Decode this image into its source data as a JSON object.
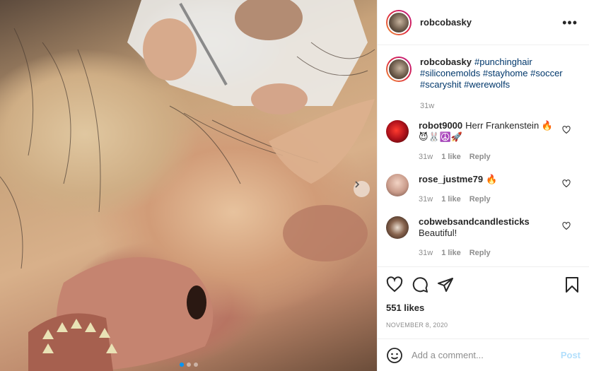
{
  "post": {
    "author": "robcobasky",
    "more_label": "•••",
    "carousel_dots": 3,
    "carousel_active": 1,
    "caption": {
      "username": "robcobasky",
      "tags": [
        "#punchinghair",
        "#siliconemolds",
        "#stayhome",
        "#soccer",
        "#scaryshit",
        "#werewolfs"
      ],
      "age": "31w"
    },
    "comments": [
      {
        "username": "robot9000",
        "text": "Herr Frankenstein 🔥 😈🐰☮️🚀",
        "age": "31w",
        "likes": "1 like",
        "reply": "Reply",
        "color": "#b0121b"
      },
      {
        "username": "rose_justme79",
        "text": "🔥",
        "age": "31w",
        "likes": "1 like",
        "reply": "Reply",
        "color": "#c99b8a"
      },
      {
        "username": "cobwebsandcandlesticks",
        "text": "Beautiful!",
        "age": "31w",
        "likes": "1 like",
        "reply": "Reply",
        "color": "#5a3a2a"
      }
    ],
    "likes_count": "551 likes",
    "date": "NOVEMBER 8, 2020",
    "comment_placeholder": "Add a comment...",
    "post_button": "Post"
  },
  "colors": {
    "accent": "#0095f6",
    "link": "#00376b",
    "muted": "#8e8e8e",
    "post_disabled": "#b2dffc"
  },
  "icons": [
    "more-icon",
    "heart-icon",
    "comment-icon",
    "share-icon",
    "save-icon",
    "emoji-icon",
    "chevron-right-icon"
  ]
}
